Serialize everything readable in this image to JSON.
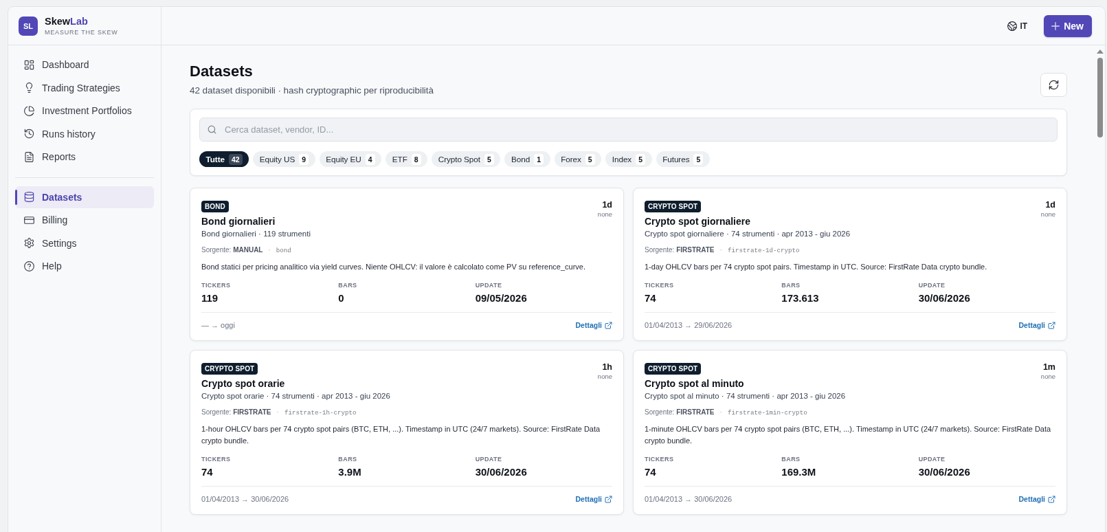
{
  "sidebar": {
    "brand": {
      "logo": "SL",
      "name": "Skew",
      "name_accent": "Lab",
      "tagline": "MEASURE THE SKEW"
    },
    "groups": [
      {
        "items": [
          {
            "label": "Dashboard",
            "selected": false
          },
          {
            "label": "Trading Strategies",
            "selected": false
          },
          {
            "label": "Investment Portfolios",
            "selected": false
          },
          {
            "label": "Runs history",
            "selected": false
          },
          {
            "label": "Reports",
            "selected": false
          }
        ]
      },
      {
        "items": [
          {
            "label": "Datasets",
            "selected": true
          },
          {
            "label": "Billing",
            "selected": false
          },
          {
            "label": "Settings",
            "selected": false
          },
          {
            "label": "Help",
            "selected": false
          }
        ]
      }
    ]
  },
  "header": {
    "language": "IT",
    "new_button": "New"
  },
  "page": {
    "title": "Datasets",
    "subtitle": "42 dataset disponibili · hash cryptographic per riproducibilità"
  },
  "filters": {
    "search": {
      "placeholder": "Cerca dataset, vendor, ID..."
    },
    "chips": [
      {
        "label": "Tutte",
        "count": "42",
        "selected": true
      },
      {
        "label": "Equity US",
        "count": "9",
        "selected": false
      },
      {
        "label": "Equity EU",
        "count": "4",
        "selected": false
      },
      {
        "label": "ETF",
        "count": "8",
        "selected": false
      },
      {
        "label": "Crypto Spot",
        "count": "5",
        "selected": false
      },
      {
        "label": "Bond",
        "count": "1",
        "selected": false
      },
      {
        "label": "Forex",
        "count": "5",
        "selected": false
      },
      {
        "label": "Index",
        "count": "5",
        "selected": false
      },
      {
        "label": "Futures",
        "count": "5",
        "selected": false
      }
    ]
  },
  "datasets": [
    {
      "badge": "BOND",
      "title": "Bond giornalieri",
      "summary": "Bond giornalieri · 119 strumenti",
      "frequency": "1d",
      "adjustment": "none",
      "source": "Sorgente: **MANUAL**",
      "separator": "·",
      "id": "bond",
      "description": "Bond statici per pricing analitico via yield curves. Niente OHLCV: il valore è calcolato come PV su reference_curve.",
      "stats": [
        {
          "label": "TICKERS",
          "value": "119"
        },
        {
          "label": "BARS",
          "value": "0"
        },
        {
          "label": "UPDATE",
          "value": "09/05/2026"
        }
      ],
      "range": "— → oggi",
      "link": "Dettagli"
    },
    {
      "badge": "CRYPTO SPOT",
      "title": "Crypto spot giornaliere",
      "summary": "Crypto spot giornaliere · 74 strumenti · apr 2013 - giu 2026",
      "frequency": "1d",
      "adjustment": "none",
      "source": "Sorgente: **FIRSTRATE**",
      "separator": "·",
      "id": "firstrate-1d-crypto",
      "description": "1-day OHLCV bars per 74 crypto spot pairs. Timestamp in UTC. Source: FirstRate Data crypto bundle.",
      "stats": [
        {
          "label": "TICKERS",
          "value": "74"
        },
        {
          "label": "BARS",
          "value": "173.613"
        },
        {
          "label": "UPDATE",
          "value": "30/06/2026"
        }
      ],
      "range": "01/04/2013 → 29/06/2026",
      "link": "Dettagli"
    },
    {
      "badge": "CRYPTO SPOT",
      "title": "Crypto spot orarie",
      "summary": "Crypto spot orarie · 74 strumenti · apr 2013 - giu 2026",
      "frequency": "1h",
      "adjustment": "none",
      "source": "Sorgente: **FIRSTRATE**",
      "separator": "·",
      "id": "firstrate-1h-crypto",
      "description": "1-hour OHLCV bars per 74 crypto spot pairs (BTC, ETH, ...). Timestamp in UTC (24/7 markets). Source: FirstRate Data crypto bundle.",
      "stats": [
        {
          "label": "TICKERS",
          "value": "74"
        },
        {
          "label": "BARS",
          "value": "3.9M"
        },
        {
          "label": "UPDATE",
          "value": "30/06/2026"
        }
      ],
      "range": "01/04/2013 → 30/06/2026",
      "link": "Dettagli"
    },
    {
      "badge": "CRYPTO SPOT",
      "title": "Crypto spot al minuto",
      "summary": "Crypto spot al minuto · 74 strumenti · apr 2013 - giu 2026",
      "frequency": "1m",
      "adjustment": "none",
      "source": "Sorgente: **FIRSTRATE**",
      "separator": "·",
      "id": "firstrate-1min-crypto",
      "description": "1-minute OHLCV bars per 74 crypto spot pairs (BTC, ETH, ...). Timestamp in UTC (24/7 markets). Source: FirstRate Data crypto bundle.",
      "stats": [
        {
          "label": "TICKERS",
          "value": "74"
        },
        {
          "label": "BARS",
          "value": "169.3M"
        },
        {
          "label": "UPDATE",
          "value": "30/06/2026"
        }
      ],
      "range": "01/04/2013 → 30/06/2026",
      "link": "Dettagli"
    }
  ]
}
